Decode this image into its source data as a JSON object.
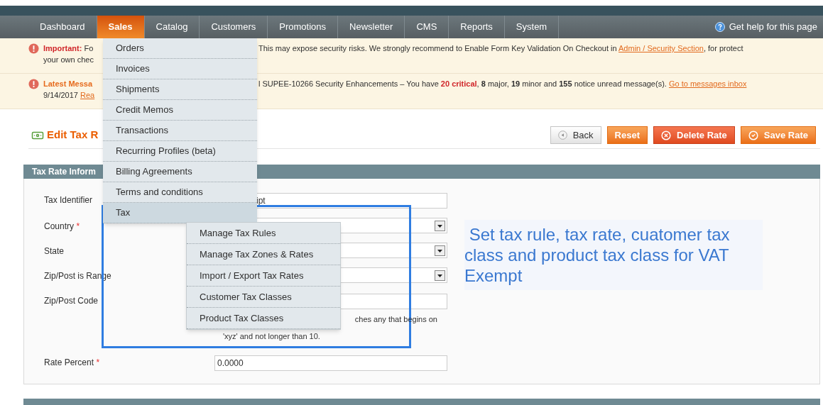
{
  "nav": {
    "items": [
      {
        "label": "Dashboard",
        "selected": false
      },
      {
        "label": "Sales",
        "selected": true
      },
      {
        "label": "Catalog",
        "selected": false
      },
      {
        "label": "Customers",
        "selected": false
      },
      {
        "label": "Promotions",
        "selected": false
      },
      {
        "label": "Newsletter",
        "selected": false
      },
      {
        "label": "CMS",
        "selected": false
      },
      {
        "label": "Reports",
        "selected": false
      },
      {
        "label": "System",
        "selected": false
      }
    ],
    "help": "Get help for this page"
  },
  "messages": [
    {
      "left_lines": [
        [
          {
            "kind": "alert",
            "text": "Important:"
          },
          {
            "kind": "text",
            "text": " Fo"
          }
        ],
        [
          {
            "kind": "text",
            "text": "your own chec"
          }
        ]
      ],
      "right": [
        {
          "kind": "text",
          "text": "This may expose security risks. We strongly recommend to Enable Form Key Validation On Checkout in "
        },
        {
          "kind": "link",
          "text": "Admin / Security Section"
        },
        {
          "kind": "text",
          "text": ", for protect"
        }
      ]
    },
    {
      "left_lines": [
        [
          {
            "kind": "heading",
            "text": "Latest Messa"
          }
        ],
        [
          {
            "kind": "text",
            "text": "9/14/2017 "
          },
          {
            "kind": "link",
            "text": "Rea"
          }
        ]
      ],
      "right": [
        {
          "kind": "text",
          "text": "l SUPEE-10266 Security Enhancements –  You have "
        },
        {
          "kind": "alert",
          "text": "20 critical"
        },
        {
          "kind": "text",
          "text": ", "
        },
        {
          "kind": "strong",
          "text": "8"
        },
        {
          "kind": "text",
          "text": " major, "
        },
        {
          "kind": "strong",
          "text": "19"
        },
        {
          "kind": "text",
          "text": " minor and "
        },
        {
          "kind": "strong",
          "text": "155"
        },
        {
          "kind": "text",
          "text": " notice unread message(s). "
        },
        {
          "kind": "link",
          "text": "Go to messages inbox"
        }
      ]
    }
  ],
  "page_title": "Edit Tax R",
  "buttons": [
    {
      "kind": "back",
      "label": "Back"
    },
    {
      "kind": "reset",
      "label": "Reset"
    },
    {
      "kind": "delete",
      "label": "Delete Rate"
    },
    {
      "kind": "save",
      "label": "Save Rate"
    }
  ],
  "section_title": "Tax Rate Inform",
  "required_mark": "*",
  "form": [
    {
      "label": "Tax Identifier",
      "required": false,
      "kind": "text",
      "value": "ipt"
    },
    {
      "label": "Country",
      "required": true,
      "kind": "select"
    },
    {
      "label": "State",
      "required": false,
      "kind": "select"
    },
    {
      "label": "Zip/Post is Range",
      "required": false,
      "kind": "select"
    },
    {
      "label": "Zip/Post Code",
      "required": false,
      "kind": "text",
      "hint": [
        "ches any that begins on",
        "'xyz' and not longer than 10."
      ]
    },
    {
      "label": "Rate Percent",
      "required": true,
      "kind": "text",
      "value": "0.0000"
    }
  ],
  "annotation": " Set tax rule, tax rate, cuatomer tax class and product tax class for VAT Exempt",
  "sales_menu": [
    {
      "label": "Orders",
      "selected": false
    },
    {
      "label": "Invoices",
      "selected": false
    },
    {
      "label": "Shipments",
      "selected": false
    },
    {
      "label": "Credit Memos",
      "selected": false
    },
    {
      "label": "Transactions",
      "selected": false
    },
    {
      "label": "Recurring Profiles (beta)",
      "selected": false
    },
    {
      "label": "Billing Agreements",
      "selected": false
    },
    {
      "label": "Terms and conditions",
      "selected": false
    },
    {
      "label": "Tax",
      "selected": true
    }
  ],
  "tax_menu": [
    {
      "label": "Manage Tax Rules"
    },
    {
      "label": "Manage Tax Zones & Rates"
    },
    {
      "label": "Import / Export Tax Rates"
    },
    {
      "label": "Customer Tax Classes"
    },
    {
      "label": "Product Tax Classes"
    }
  ]
}
